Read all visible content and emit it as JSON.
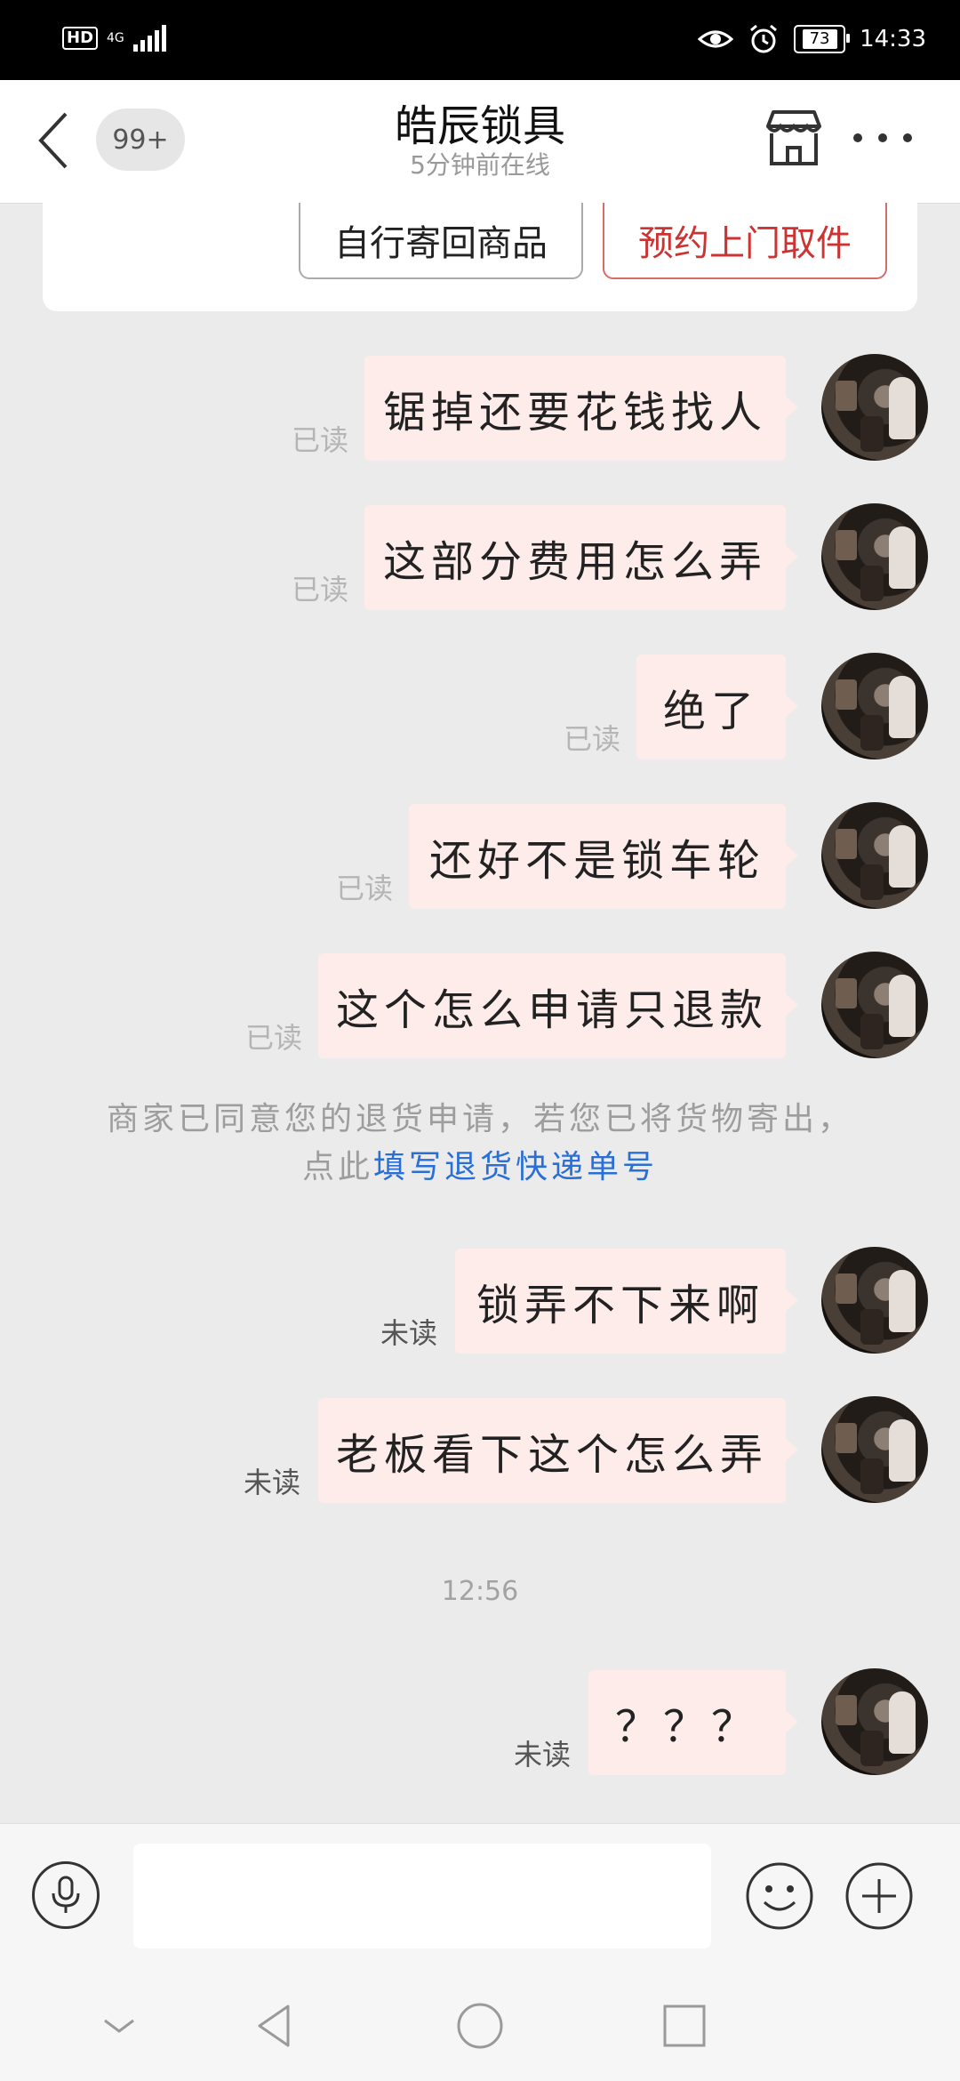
{
  "status_bar": {
    "hd": "HD",
    "network": "4G",
    "battery": "73",
    "time": "14:33"
  },
  "header": {
    "unread_count": "99+",
    "shop_name": "皓辰锁具",
    "online_status": "5分钟前在线"
  },
  "top_card": {
    "self_return_label": "自行寄回商品",
    "pickup_label": "预约上门取件"
  },
  "messages": [
    {
      "text": "锯掉还要花钱找人",
      "status": "已读"
    },
    {
      "text": "这部分费用怎么弄",
      "status": "已读"
    },
    {
      "text": "绝了",
      "status": "已读"
    },
    {
      "text": "还好不是锁车轮",
      "status": "已读"
    },
    {
      "text": "这个怎么申请只退款",
      "status": "已读"
    },
    {
      "text": "锁弄不下来啊",
      "status": "未读"
    },
    {
      "text": "老板看下这个怎么弄",
      "status": "未读"
    },
    {
      "text": "？？？",
      "status": "未读"
    }
  ],
  "system_notice": {
    "text": "商家已同意您的退货申请，若您已将货物寄出，点此",
    "link": "填写退货快递单号"
  },
  "timestamp": "12:56",
  "input": {
    "placeholder": ""
  },
  "colors": {
    "bubble": "#fdecea",
    "link": "#2a6fd6",
    "pickup_accent": "#cc3333"
  },
  "icons": {
    "back": "back-chevron-icon",
    "store": "store-icon",
    "more": "more-dots-icon",
    "voice": "microphone-icon",
    "emoji": "smiley-icon",
    "plus": "plus-circle-icon",
    "nav_down": "chevron-down-icon",
    "nav_back": "triangle-back-icon",
    "nav_home": "circle-home-icon",
    "nav_recent": "square-recent-icon"
  }
}
